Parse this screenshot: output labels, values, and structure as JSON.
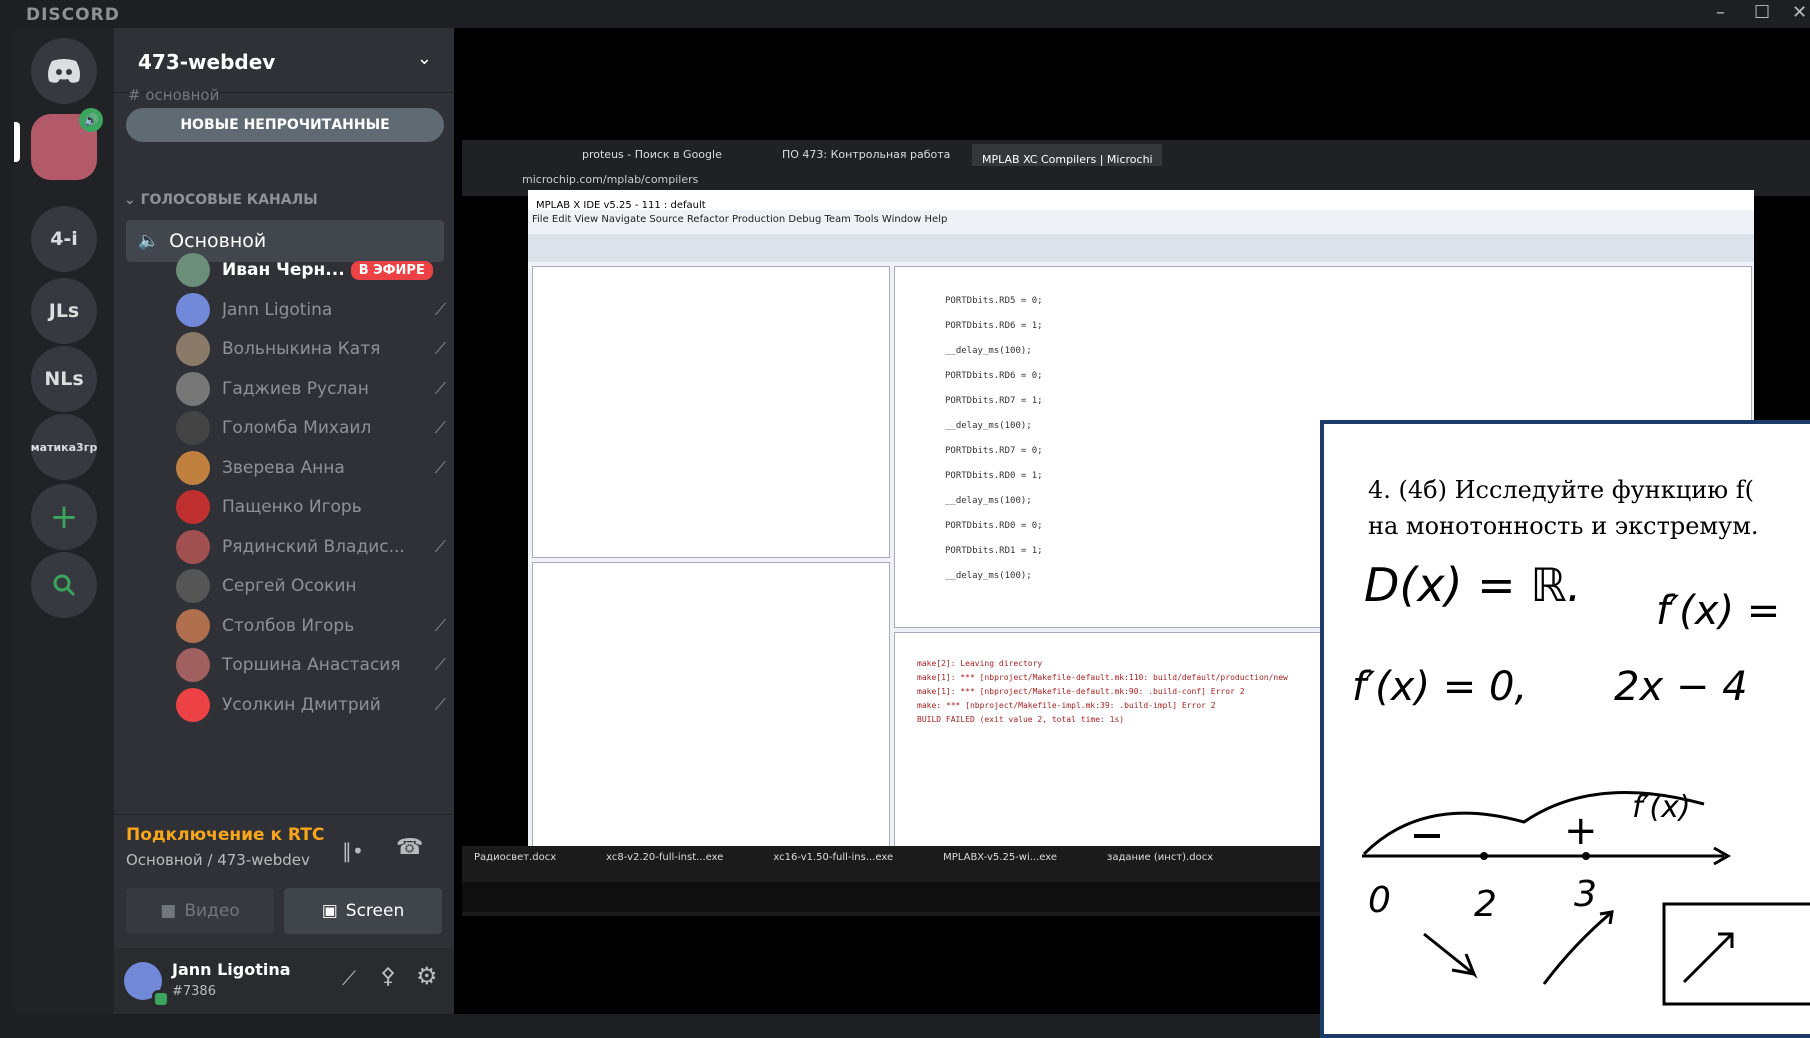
{
  "app": {
    "brand": "DISCORD"
  },
  "rail": {
    "items": [
      {
        "name": "home",
        "label": ""
      },
      {
        "name": "server-active",
        "label": ""
      },
      {
        "name": "4i",
        "label": "4-i"
      },
      {
        "name": "jls",
        "label": "JLs"
      },
      {
        "name": "nls",
        "label": "NLs"
      },
      {
        "name": "matika",
        "label": "матика3гр"
      },
      {
        "name": "add",
        "label": "+"
      },
      {
        "name": "search",
        "label": ""
      }
    ]
  },
  "server": {
    "name": "473-webdev",
    "unread_banner": "НОВЫЕ НЕПРОЧИТАННЫЕ",
    "ghost_channel": "# основной"
  },
  "voice": {
    "category": "ГОЛОСОВЫЕ КАНАЛЫ",
    "channel": "Основной",
    "live_badge": "В ЭФИРЕ",
    "users": [
      {
        "name": "Иван Черн...",
        "live": true,
        "muted": false,
        "color": "#6b8e7a"
      },
      {
        "name": "Jann Ligotina",
        "live": false,
        "muted": true,
        "color": "#7289da"
      },
      {
        "name": "Вольныкина Катя",
        "live": false,
        "muted": true,
        "color": "#8a7a6a"
      },
      {
        "name": "Гаджиев Руслан",
        "live": false,
        "muted": true,
        "color": "#777777"
      },
      {
        "name": "Голомба Михаил",
        "live": false,
        "muted": true,
        "color": "#444444"
      },
      {
        "name": "Зверева Анна",
        "live": false,
        "muted": true,
        "color": "#c08040"
      },
      {
        "name": "Пащенко Игорь",
        "live": false,
        "muted": false,
        "color": "#c03030"
      },
      {
        "name": "Рядинский Владис...",
        "live": false,
        "muted": true,
        "color": "#a05050"
      },
      {
        "name": "Сергей Осокин",
        "live": false,
        "muted": false,
        "color": "#555555"
      },
      {
        "name": "Столбов Игорь",
        "live": false,
        "muted": true,
        "color": "#b07050"
      },
      {
        "name": "Торшина Анастасия",
        "live": false,
        "muted": true,
        "color": "#a06060"
      },
      {
        "name": "Усолкин Дмитрий",
        "live": false,
        "muted": true,
        "color": "#ed4245"
      }
    ]
  },
  "rtc": {
    "status": "Подключение к RTC",
    "location": "Основной / 473-webdev"
  },
  "buttons": {
    "video": "Видео",
    "screen": "Screen"
  },
  "self": {
    "name": "Jann Ligotina",
    "tag": "#7386"
  },
  "stream": {
    "tab1": "proteus - Поиск в Google",
    "tab2": "ПО 473: Контрольная работа",
    "tab3": "MPLAB XC Compilers | Microchi",
    "url": "microchip.com/mplab/compilers",
    "ide_title": "MPLAB X IDE v5.25 - 111 : default",
    "ide_menu": "File  Edit  View  Navigate  Source  Refactor  Production  Debug  Team  Tools  Window  Help",
    "code_lines": [
      "PORTDbits.RD5 = 0;",
      "PORTDbits.RD6 = 1;",
      "__delay_ms(100);",
      "PORTDbits.RD6 = 0;",
      "PORTDbits.RD7 = 1;",
      "__delay_ms(100);",
      "PORTDbits.RD7 = 0;",
      "PORTDbits.RD0 = 1;",
      "__delay_ms(100);",
      "PORTDbits.RD0 = 0;",
      "PORTDbits.RD1 = 1;",
      "__delay_ms(100);"
    ],
    "output_lines": [
      "make[2]: Leaving directory",
      "make[1]: *** [nbproject/Makefile-default.mk:110: build/default/production/new",
      "make[1]: *** [nbproject/Makefile-default.mk:90: .build-conf] Error 2",
      "make: *** [nbproject/Makefile-impl.mk:39: .build-impl] Error 2",
      "BUILD FAILED (exit value 2, total time: 1s)"
    ],
    "taskbar_items": [
      "Радиосвет.docx",
      "xc8-v2.20-full-inst...exe",
      "xc16-v1.50-full-ins...exe",
      "MPLABX-v5.25-wi...exe",
      "задание (инст).docx"
    ]
  },
  "math": {
    "task_line1": "4. (4б) Исследуйте функцию f(",
    "task_line2": "на монотонность и экстремум.",
    "hw1": "D(x) = ℝ.",
    "hw2": "f′(x) =",
    "hw3": "f′(x) = 0,",
    "hw4": "2x − 4",
    "hw5": "f′(x)",
    "nums": [
      "0",
      "2",
      "3"
    ],
    "plus": "+",
    "minus": "−"
  }
}
